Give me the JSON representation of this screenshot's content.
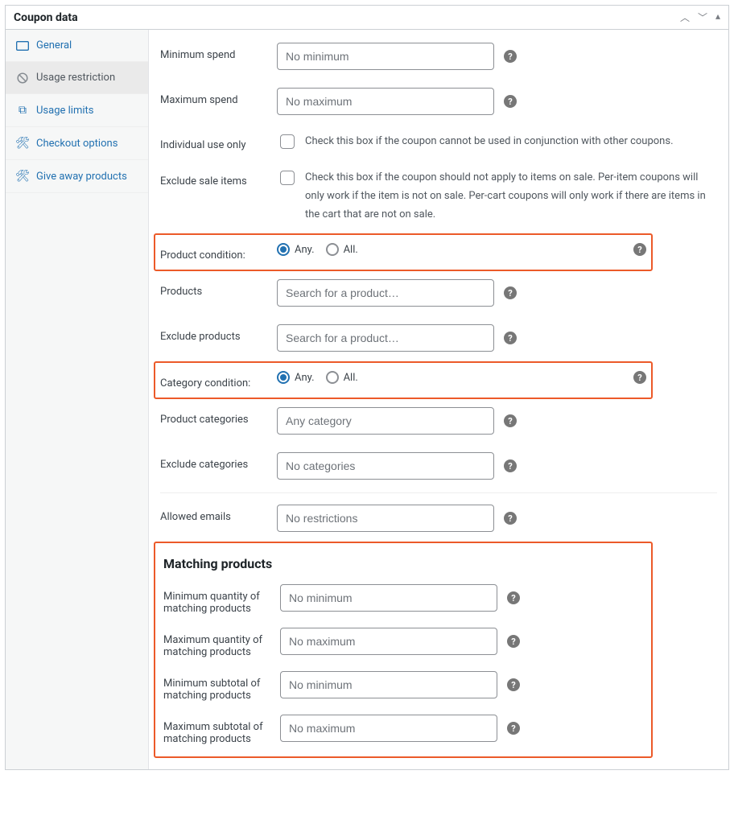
{
  "panel": {
    "title": "Coupon data"
  },
  "sidebar": {
    "general": "General",
    "usage_restriction": "Usage restriction",
    "usage_limits": "Usage limits",
    "checkout_options": "Checkout options",
    "give_away": "Give away products"
  },
  "labels": {
    "min_spend": "Minimum spend",
    "max_spend": "Maximum spend",
    "individual": "Individual use only",
    "exclude_sale": "Exclude sale items",
    "product_cond": "Product condition:",
    "products": "Products",
    "exclude_products": "Exclude products",
    "category_cond": "Category condition:",
    "prod_categories": "Product categories",
    "exclude_categories": "Exclude categories",
    "allowed_emails": "Allowed emails",
    "matching_title": "Matching products",
    "min_qty": "Minimum quantity of matching products",
    "max_qty": "Maximum quantity of matching products",
    "min_sub": "Minimum subtotal of matching products",
    "max_sub": "Maximum subtotal of matching products"
  },
  "placeholders": {
    "no_min": "No minimum",
    "no_max": "No maximum",
    "search_product": "Search for a product…",
    "any_category": "Any category",
    "no_categories": "No categories",
    "no_restrictions": "No restrictions"
  },
  "desc": {
    "individual": "Check this box if the coupon cannot be used in conjunction with other coupons.",
    "exclude_sale": "Check this box if the coupon should not apply to items on sale. Per-item coupons will only work if the item is not on sale. Per-cart coupons will only work if there are items in the cart that are not on sale."
  },
  "radio": {
    "any": "Any.",
    "all": "All."
  },
  "help": "?"
}
